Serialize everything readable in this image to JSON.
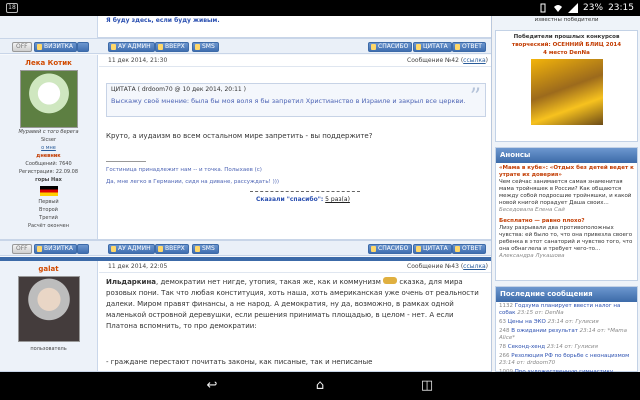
{
  "statusbar": {
    "notif_count": "18",
    "battery": "23%",
    "time": "23:15"
  },
  "top_post": {
    "signature": "Я буду здесь, если буду живым.",
    "buttons": {
      "off": "OFF",
      "profile": "ВИЗИТКА",
      "admin": "АУ АДМИН",
      "top": "ВВЕРХ",
      "sms": "SMS",
      "thanks": "СПАСИБО",
      "quote": "ЦИТАТА",
      "reply": "ОТВЕТ"
    }
  },
  "post42": {
    "username": "Лека Котик",
    "caption": "Муравей с того берега",
    "status_line": "Sicser",
    "about_link": "о мне",
    "diary": "дневник",
    "messages": "Сообщений: 7640",
    "registered": "Регистрация: 22.09.08",
    "city": "горы Нах",
    "ranks": [
      "Первый",
      "Второй",
      "Третий"
    ],
    "finished": "Расчёт окончен",
    "date": "11 дек 2014, 21:30",
    "number": "Сообщение №42",
    "link": "ссылка",
    "quote_header": "ЦИТАТА ( drdoom70 @ 10 дек 2014, 20:11 )",
    "quote_text": "Выскажу своё мнение: была бы моя воля я бы запретил Христианство в Израиле и закрыл все церкви.",
    "body": "Круто, а иудаизм во всем остальном мире запретить - вы поддержите?",
    "sig1": "Гостиница принадлежит нам -- и точка. Полыхаев (с)",
    "sig2": "Да, мне легко в Германии, сидя на диване, рассуждать! )))",
    "thanks_label": "Сказали \"спасибо\":",
    "thanks_count": "5 раз(а)"
  },
  "post43": {
    "username": "galat",
    "role": "пользователь",
    "date": "11 дек 2014, 22:05",
    "number": "Сообщение №43",
    "link": "ссылка",
    "body_author": "Ильдаркина",
    "body": ", демократии нет нигде, утопия, такая же, как и коммунизм",
    "body2": " сказка, для мира розовых пони. Так что любая конституция, хоть наша, хоть американская уже очень от реальности далеки. Миром правят финансы, а не народ. А демократия, ну да, возможно, в рамках одной маленькой островной деревушки, если решения принимать площадью, в целом - нет. А если Платона вспомнить, то про демократии:",
    "body3": "- граждане перестают почитать законы, как писаные, так и неписаные"
  },
  "sidebar": {
    "winners_title": "известны победители",
    "past_winners": "Победители прошлых конкурсов",
    "contest": "творческий: ОСЕННИЙ БЛИЦ 2014",
    "place": "4 место DenNa",
    "announce_title": "Анонсы",
    "a1_title": "«Мама в кубе»: «Отдых без детей ведет к утрате их доверия»",
    "a1_text": "Чем сейчас занимается самая знаменитая мама тройняшек в России? Как общаются между собой подросшие тройняшки, и какой новой книгой порадует Даша своих...",
    "a1_author": "Беседовала Елена Сай",
    "a2_title": "Бесплатно — равно плохо?",
    "a2_text": "Лизу разрывали два противоположных чувства: ей было то, что она привезла своего ребенка в этот санаторий и чувство того, что она обнаглела и требует чего-то...",
    "a2_author": "Александра Лукашова",
    "recent_title": "Последние сообщения",
    "recent": [
      {
        "count": "1132",
        "text": "Годзума планирует ввести налог на собак",
        "meta": "23:15 от: DenNa"
      },
      {
        "count": "63",
        "text": "Цены на ЭКО",
        "meta": "23:14 от: Гулисия"
      },
      {
        "count": "248",
        "text": "В ожидании результат",
        "meta": "23:14 от: *Mama Alice*"
      },
      {
        "count": "78",
        "text": "Секонд-хенд",
        "meta": "23:14 от: Гулисия"
      },
      {
        "count": "266",
        "text": "Резолюция РФ по борьбе с неонацизмом",
        "meta": "23:14 от: drdoom70"
      },
      {
        "count": "1009",
        "text": "Про художественную гимнастику",
        "meta": ""
      }
    ]
  },
  "icons": {
    "back": "back-icon",
    "home": "home-icon",
    "recents": "recents-icon"
  }
}
